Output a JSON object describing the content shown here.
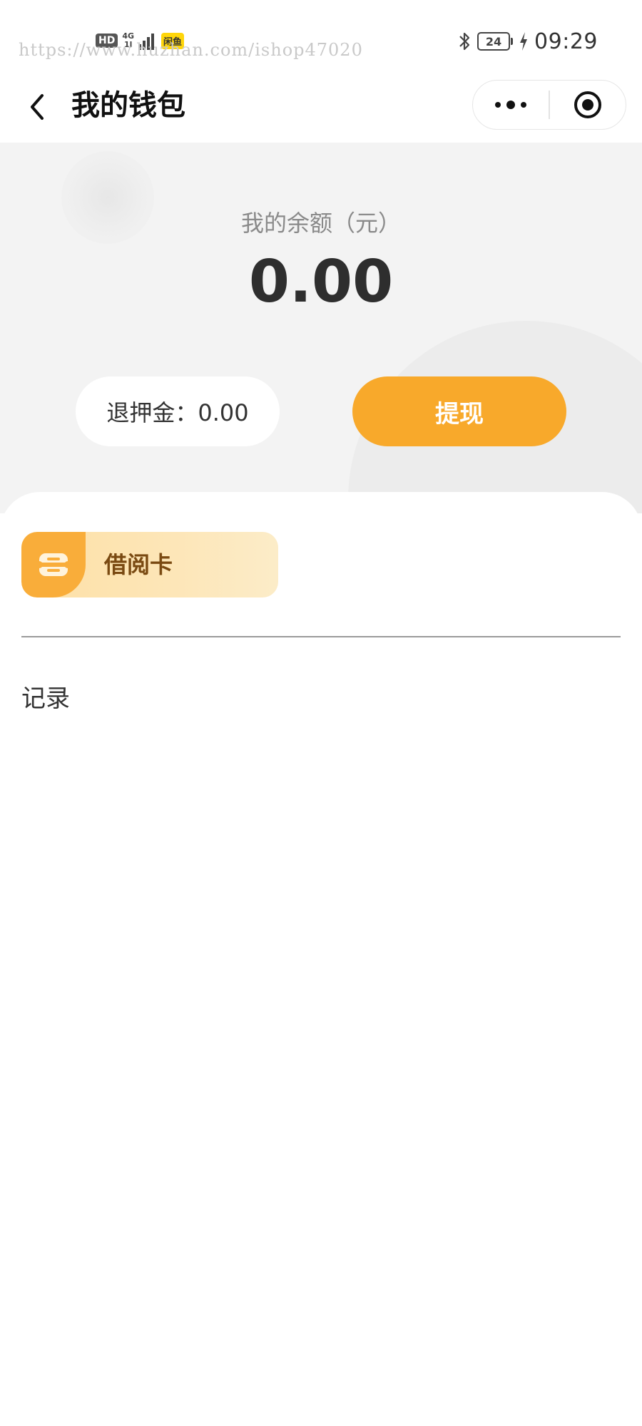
{
  "status_bar": {
    "network_hd": "HD",
    "network_type": "4G",
    "network_sub": "1l",
    "app_badge": "闲鱼",
    "battery_level": "24",
    "time": "09:29",
    "watermark": "https://www.huzhan.com/ishop47020"
  },
  "nav": {
    "title": "我的钱包",
    "back_icon": "chevron-left-icon",
    "more_icon": "more-dots-icon",
    "close_icon": "target-circle-icon"
  },
  "balance": {
    "label": "我的余额（元）",
    "amount": "0.00",
    "deposit_text": "退押金：0.00",
    "withdraw_label": "提现"
  },
  "content": {
    "card_label": "借阅卡",
    "card_icon": "card-icon",
    "records_label": "记录"
  },
  "colors": {
    "accent": "#f8a92b",
    "card_gradient_start": "#fde0a6",
    "card_text": "#7a4a12",
    "header_bg": "#f3f3f3"
  }
}
